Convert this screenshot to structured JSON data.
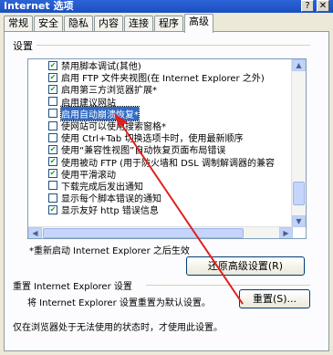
{
  "window": {
    "title": "Internet 选项",
    "help_button": "?"
  },
  "tabs": [
    {
      "label": "常规",
      "active": false
    },
    {
      "label": "安全",
      "active": false
    },
    {
      "label": "隐私",
      "active": false
    },
    {
      "label": "内容",
      "active": false
    },
    {
      "label": "连接",
      "active": false
    },
    {
      "label": "程序",
      "active": false
    },
    {
      "label": "高级",
      "active": true
    }
  ],
  "settings_label": "设置",
  "settings_list": [
    {
      "text": "禁用脚本调试(其他)",
      "checked": true,
      "selected": false
    },
    {
      "text": "启用 FTP 文件夹视图(在 Internet Explorer 之外)",
      "checked": true,
      "selected": false
    },
    {
      "text": "启用第三方浏览器扩展*",
      "checked": true,
      "selected": false
    },
    {
      "text": "启用建议网站",
      "checked": false,
      "selected": false
    },
    {
      "text": "启用自动崩溃恢复*",
      "checked": false,
      "selected": true
    },
    {
      "text": "使网站可以使用搜索窗格*",
      "checked": false,
      "selected": false
    },
    {
      "text": "使用 Ctrl+Tab 切换选项卡时，使用最新顺序",
      "checked": false,
      "selected": false
    },
    {
      "text": "使用“兼容性视图”自动恢复页面布局错误",
      "checked": true,
      "selected": false
    },
    {
      "text": "使用被动 FTP (用于防火墙和 DSL 调制解调器的兼容",
      "checked": true,
      "selected": false
    },
    {
      "text": "使用平滑滚动",
      "checked": true,
      "selected": false
    },
    {
      "text": "下载完成后发出通知",
      "checked": false,
      "selected": false
    },
    {
      "text": "显示每个脚本错误的通知",
      "checked": false,
      "selected": false
    },
    {
      "text": "显示友好 http 错误信息",
      "checked": true,
      "selected": false
    }
  ],
  "restart_note": "*重新启动 Internet Explorer 之后生效",
  "restore_advanced_button": "还原高级设置(R)",
  "reset_group_label": "重置 Internet Explorer 设置",
  "reset_description": "将 Internet Explorer 设置重置为默认设置。",
  "reset_button": "重置(S)...",
  "reset_condition_note": "仅在浏览器处于无法使用的状态时，才使用此设置。",
  "annotation_arrow_color": "#e02020"
}
